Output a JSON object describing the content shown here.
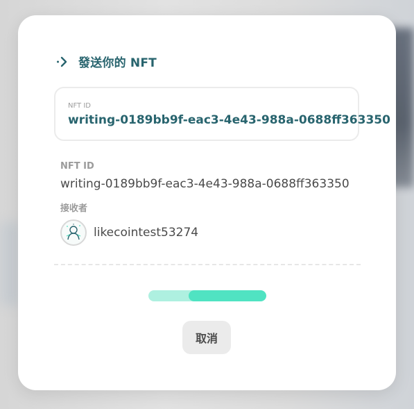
{
  "dialog": {
    "title": "發送你的 NFT",
    "icon": "send-arrow-icon"
  },
  "nft_input": {
    "label": "NFT ID",
    "value": "writing-0189bb9f-eac3-4e43-988a-0688ff363350"
  },
  "summary": {
    "nft_id_label": "NFT ID",
    "nft_id_value": "writing-0189bb9f-eac3-4e43-988a-0688ff363350",
    "receiver_label": "接收者",
    "receiver_name": "likecointest53274",
    "receiver_avatar_icon": "user-avatar-icon"
  },
  "progress": {
    "indeterminate": true,
    "fill_start_fraction": 0.34,
    "fill_end_fraction": 1.0,
    "track_color": "#aef0e0",
    "fill_color": "#50e3c2"
  },
  "actions": {
    "cancel_label": "取消"
  },
  "colors": {
    "accent": "#28646e",
    "muted_text": "#9b9b9b",
    "body_text": "#4a4a4a"
  }
}
